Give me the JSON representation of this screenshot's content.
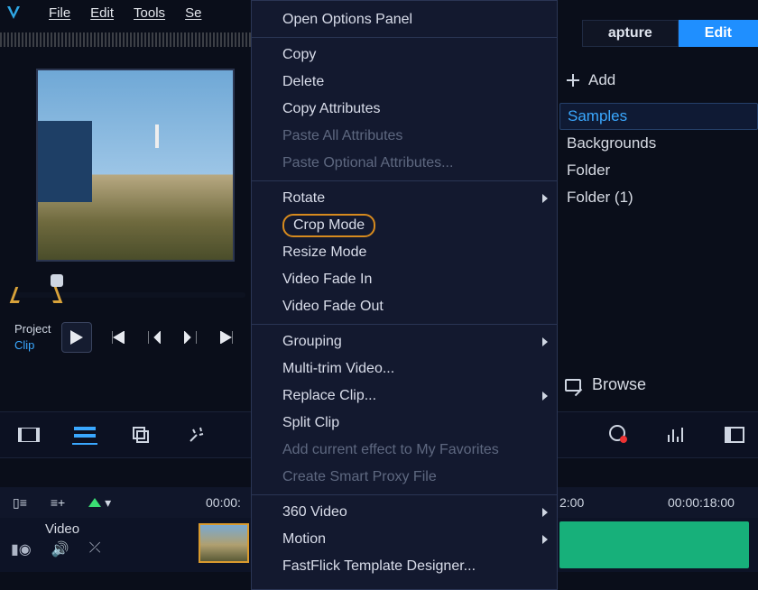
{
  "menubar": {
    "file": "File",
    "edit": "Edit",
    "tools": "Tools",
    "settings_visible": "Se"
  },
  "workspace_tabs": {
    "capture_visible": "apture",
    "edit": "Edit"
  },
  "transport": {
    "project": "Project",
    "clip": "Clip"
  },
  "right_panel": {
    "add": "Add",
    "items": [
      "Samples",
      "Backgrounds",
      "Folder",
      "Folder (1)"
    ]
  },
  "browse": "Browse",
  "timeline": {
    "tc1": "00:00:",
    "tc2": "2:00",
    "tc3": "00:00:18:00",
    "track_label": "Video"
  },
  "context_menu": [
    {
      "label": "Open Options Panel",
      "enabled": true
    },
    {
      "sep": true
    },
    {
      "label": "Copy",
      "enabled": true
    },
    {
      "label": "Delete",
      "enabled": true
    },
    {
      "label": "Copy Attributes",
      "enabled": true
    },
    {
      "label": "Paste All Attributes",
      "enabled": false
    },
    {
      "label": "Paste Optional Attributes...",
      "enabled": false
    },
    {
      "sep": true
    },
    {
      "label": "Rotate",
      "enabled": true,
      "submenu": true
    },
    {
      "label": "Crop Mode",
      "enabled": true,
      "highlight": true
    },
    {
      "label": "Resize Mode",
      "enabled": true
    },
    {
      "label": "Video Fade In",
      "enabled": true
    },
    {
      "label": "Video Fade Out",
      "enabled": true
    },
    {
      "sep": true
    },
    {
      "label": "Grouping",
      "enabled": true,
      "submenu": true
    },
    {
      "label": "Multi-trim Video...",
      "enabled": true
    },
    {
      "label": "Replace Clip...",
      "enabled": true,
      "submenu": true
    },
    {
      "label": "Split Clip",
      "enabled": true
    },
    {
      "label": "Add current effect to My Favorites",
      "enabled": false
    },
    {
      "label": "Create Smart Proxy File",
      "enabled": false
    },
    {
      "sep": true
    },
    {
      "label": "360 Video",
      "enabled": true,
      "submenu": true
    },
    {
      "label": "Motion",
      "enabled": true,
      "submenu": true
    },
    {
      "label": "FastFlick Template Designer...",
      "enabled": true
    }
  ]
}
